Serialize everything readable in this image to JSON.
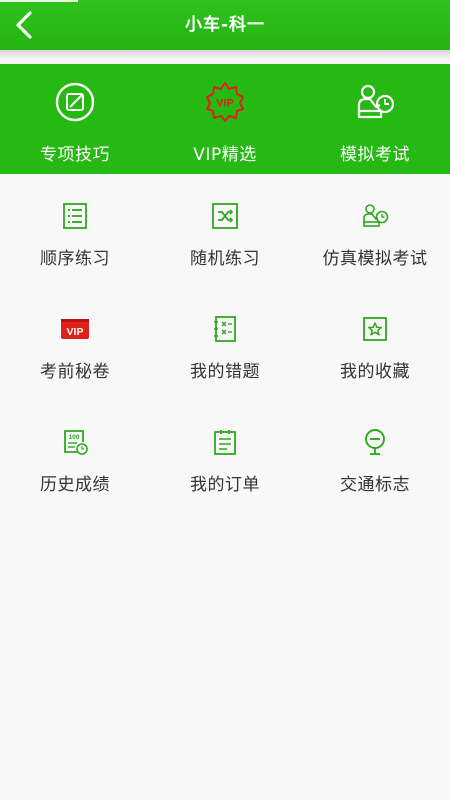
{
  "header": {
    "title": "小车-科一"
  },
  "banner": {
    "items": [
      {
        "label": "专项技巧",
        "icon": "edit-circle-icon"
      },
      {
        "label": "VIP精选",
        "icon": "vip-badge-icon",
        "badge_text": "VIP"
      },
      {
        "label": "模拟考试",
        "icon": "exam-person-icon"
      }
    ]
  },
  "grid": {
    "items": [
      {
        "label": "顺序练习",
        "icon": "list-icon"
      },
      {
        "label": "随机练习",
        "icon": "shuffle-icon"
      },
      {
        "label": "仿真模拟考试",
        "icon": "exam-person-icon"
      },
      {
        "label": "考前秘卷",
        "icon": "vip-tag-icon",
        "badge_text": "VIP"
      },
      {
        "label": "我的错题",
        "icon": "wrong-notebook-icon"
      },
      {
        "label": "我的收藏",
        "icon": "star-box-icon"
      },
      {
        "label": "历史成绩",
        "icon": "score-history-icon",
        "badge_text": "100"
      },
      {
        "label": "我的订单",
        "icon": "order-clipboard-icon"
      },
      {
        "label": "交通标志",
        "icon": "traffic-sign-icon"
      }
    ]
  },
  "colors": {
    "primary_green": "#26b914",
    "icon_green": "#2fa81e",
    "vip_red": "#e0201a"
  }
}
